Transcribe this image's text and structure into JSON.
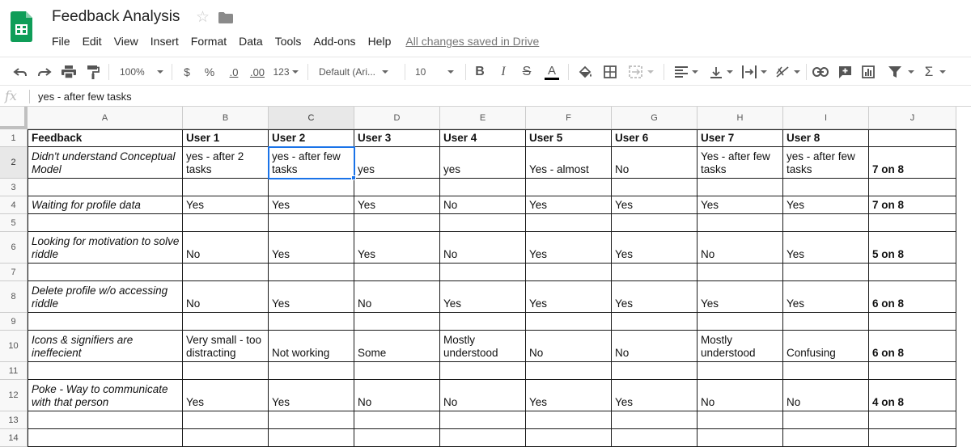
{
  "app": {
    "title": "Feedback Analysis",
    "brand_color": "#0F9D58",
    "saved_status": "All changes saved in Drive",
    "menu": [
      "File",
      "Edit",
      "View",
      "Insert",
      "Format",
      "Data",
      "Tools",
      "Add-ons",
      "Help"
    ]
  },
  "toolbar": {
    "zoom": "100%",
    "currency": "$",
    "percent": "%",
    "decrease_decimals": ".0",
    "increase_decimals": ".00",
    "more_formats": "123",
    "font": "Default (Ari...",
    "font_size": "10",
    "bold": "B",
    "italic": "I",
    "strikethrough": "S",
    "text_color_label": "A",
    "sum_symbol": "Σ",
    "icons": [
      "undo-icon",
      "redo-icon",
      "print-icon",
      "paint-format-icon",
      "fill-color-icon",
      "borders-icon",
      "merge-cells-icon",
      "horizontal-align-icon",
      "vertical-align-icon",
      "text-wrapping-icon",
      "text-rotation-icon",
      "insert-link-icon",
      "insert-comment-icon",
      "insert-chart-icon",
      "filter-icon",
      "functions-icon"
    ]
  },
  "formula": {
    "fx": "fx",
    "value": "yes - after few tasks"
  },
  "sheet": {
    "selected_cell": "C2",
    "columns": [
      "A",
      "B",
      "C",
      "D",
      "E",
      "F",
      "G",
      "H",
      "I",
      "J"
    ],
    "rows": [
      "1",
      "2",
      "3",
      "4",
      "5",
      "6",
      "7",
      "8",
      "9",
      "10",
      "11",
      "12",
      "13",
      "14"
    ],
    "cells": [
      [
        "Feedback",
        "User 1",
        "User 2",
        "User 3",
        "User 4",
        "User 5",
        "User 6",
        "User 7",
        "User 8",
        ""
      ],
      [
        "Didn't understand Conceptual Model",
        "yes - after 2 tasks",
        "yes - after few tasks",
        "yes",
        "yes",
        "Yes - almost",
        "No",
        "Yes - after few tasks",
        "yes - after few tasks",
        "7 on 8"
      ],
      [
        "",
        "",
        "",
        "",
        "",
        "",
        "",
        "",
        "",
        ""
      ],
      [
        "Waiting for profile data",
        "Yes",
        "Yes",
        "Yes",
        "No",
        "Yes",
        "Yes",
        "Yes",
        "Yes",
        "7 on 8"
      ],
      [
        "",
        "",
        "",
        "",
        "",
        "",
        "",
        "",
        "",
        ""
      ],
      [
        "Looking for motivation to solve riddle",
        "No",
        "Yes",
        "Yes",
        "No",
        "Yes",
        "Yes",
        "No",
        "Yes",
        "5 on 8"
      ],
      [
        "",
        "",
        "",
        "",
        "",
        "",
        "",
        "",
        "",
        ""
      ],
      [
        "Delete profile w/o accessing riddle",
        "No",
        "Yes",
        "No",
        "Yes",
        "Yes",
        "Yes",
        "Yes",
        "Yes",
        "6 on 8"
      ],
      [
        "",
        "",
        "",
        "",
        "",
        "",
        "",
        "",
        "",
        ""
      ],
      [
        "Icons & signifiers are ineffecient",
        "Very small - too distracting",
        "Not working",
        "Some",
        "Mostly understood",
        "No",
        "No",
        "Mostly understood",
        "Confusing",
        "6 on 8"
      ],
      [
        "",
        "",
        "",
        "",
        "",
        "",
        "",
        "",
        "",
        ""
      ],
      [
        "Poke - Way to communicate with that person",
        "Yes",
        "Yes",
        "No",
        "No",
        "Yes",
        "Yes",
        "No",
        "No",
        "4 on 8"
      ],
      [
        "",
        "",
        "",
        "",
        "",
        "",
        "",
        "",
        "",
        ""
      ],
      [
        "",
        "",
        "",
        "",
        "",
        "",
        "",
        "",
        "",
        ""
      ]
    ]
  }
}
